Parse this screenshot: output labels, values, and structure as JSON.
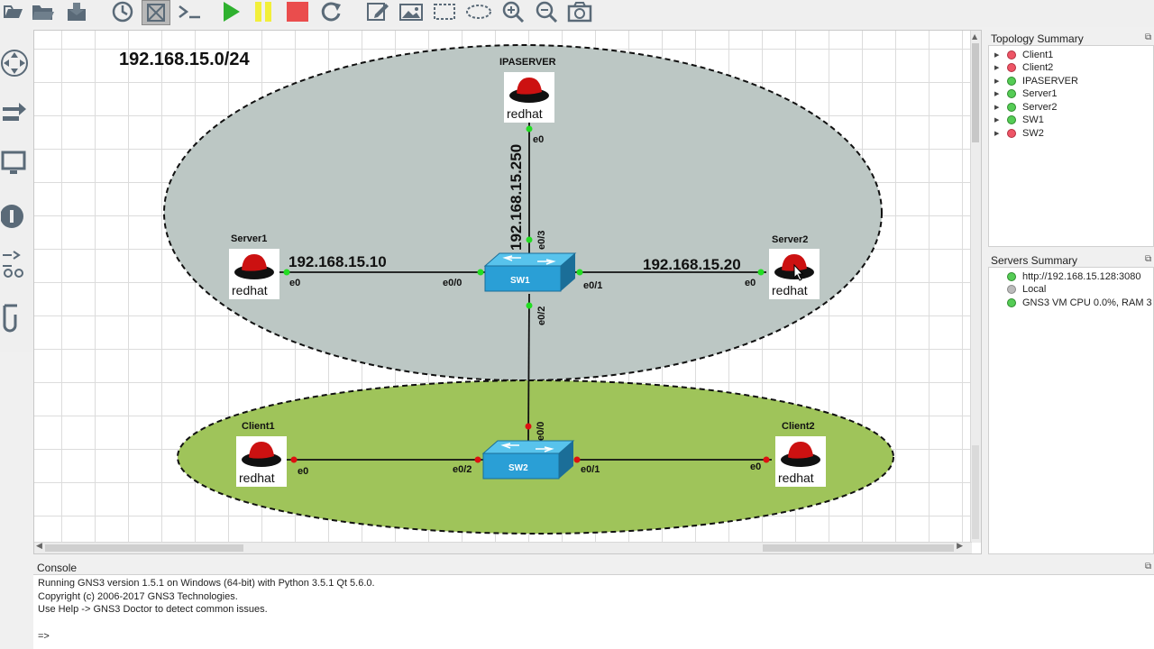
{
  "toolbar": {
    "buttons": [
      "new-project",
      "open-project",
      "save-project",
      "snapshot",
      "show-interface-labels",
      "console-all",
      "start-all",
      "suspend-all",
      "stop-all",
      "reload-all",
      "add-note",
      "insert-image",
      "draw-rectangle",
      "draw-ellipse",
      "zoom-in",
      "zoom-out",
      "screenshot"
    ]
  },
  "topology": {
    "subnet_label": "192.168.15.0/24",
    "nodes": {
      "ipaserver": {
        "name": "IPASERVER",
        "ip": "192.168.15.250",
        "port": "e0",
        "logo": "redhat"
      },
      "server1": {
        "name": "Server1",
        "ip": "192.168.15.10",
        "port": "e0",
        "logo": "redhat"
      },
      "server2": {
        "name": "Server2",
        "ip": "192.168.15.20",
        "port": "e0",
        "logo": "redhat"
      },
      "client1": {
        "name": "Client1",
        "port": "e0",
        "logo": "redhat"
      },
      "client2": {
        "name": "Client2",
        "port": "e0",
        "logo": "redhat"
      },
      "sw1": {
        "name": "SW1",
        "ports": {
          "p00": "e0/0",
          "p01": "e0/1",
          "p02": "e0/2",
          "p03": "e0/3"
        }
      },
      "sw2": {
        "name": "SW2",
        "ports": {
          "p00": "e0/0",
          "p01": "e0/1",
          "p02": "e0/2"
        }
      }
    },
    "colors": {
      "zone_top": "#bcc7c4",
      "zone_bottom": "#9fc45a",
      "link_up": "#22dd22",
      "link_down": "#dd1111",
      "switch_blue": "#2a9fd6"
    }
  },
  "topology_summary": {
    "title": "Topology Summary",
    "items": [
      {
        "name": "Client1",
        "status": "stopped"
      },
      {
        "name": "Client2",
        "status": "stopped"
      },
      {
        "name": "IPASERVER",
        "status": "started"
      },
      {
        "name": "Server1",
        "status": "started"
      },
      {
        "name": "Server2",
        "status": "started"
      },
      {
        "name": "SW1",
        "status": "started"
      },
      {
        "name": "SW2",
        "status": "stopped"
      }
    ]
  },
  "servers_summary": {
    "title": "Servers Summary",
    "items": [
      {
        "label": "http://192.168.15.128:3080",
        "status": "started"
      },
      {
        "label": "Local",
        "status": "idle"
      },
      {
        "label": "GNS3 VM CPU 0.0%, RAM 3",
        "status": "started"
      }
    ]
  },
  "console": {
    "title": "Console",
    "lines": [
      "Running GNS3 version 1.5.1 on Windows (64-bit) with Python 3.5.1 Qt 5.6.0.",
      "Copyright (c) 2006-2017 GNS3 Technologies.",
      "Use Help -> GNS3 Doctor to detect common issues."
    ],
    "prompt": "=>"
  }
}
